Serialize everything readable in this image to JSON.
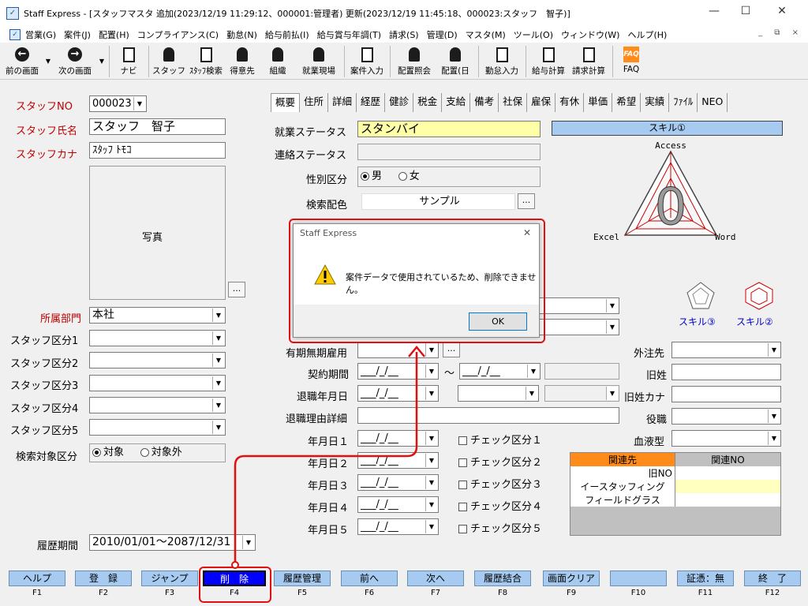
{
  "window": {
    "title": "Staff Express - [スタッフマスタ 追加(2023/12/19 11:29:12、000001:管理者) 更新(2023/12/19 11:45:18、000023:スタッフ　智子)]",
    "minimize": "—",
    "maximize": "☐",
    "close": "✕"
  },
  "menu": [
    "営業(G)",
    "案件(J)",
    "配置(H)",
    "コンプライアンス(C)",
    "勤怠(N)",
    "給与前払(I)",
    "給与賞与年調(T)",
    "請求(S)",
    "管理(D)",
    "マスタ(M)",
    "ツール(O)",
    "ウィンドウ(W)",
    "ヘルプ(H)"
  ],
  "menu_mdi": "_ ⧉ ×",
  "toolbar": [
    "前の画面",
    "次の画面",
    "ナビ",
    "スタッフ",
    "ｽﾀｯﾌ検索",
    "得意先",
    "組織",
    "就業現場",
    "案件入力",
    "配置照会",
    "配置(日",
    "勤怠入力",
    "給与計算",
    "請求計算",
    "FAQ"
  ],
  "left": {
    "staff_no_label": "スタッフNO",
    "staff_no": "000023",
    "name_label": "スタッフ氏名",
    "name": "スタッフ　智子",
    "kana_label": "スタッフカナ",
    "kana": "ｽﾀｯﾌ ﾄﾓｺ",
    "photo_label": "写真",
    "photo_btn": "...",
    "dept_label": "所属部門",
    "dept": "本社",
    "kubun": [
      "スタッフ区分1",
      "スタッフ区分2",
      "スタッフ区分3",
      "スタッフ区分4",
      "スタッフ区分5"
    ],
    "search_label": "検索対象区分",
    "search_on": "対象",
    "search_off": "対象外",
    "period_label": "履歴期間",
    "period": "2010/01/01～2087/12/31"
  },
  "tabs": [
    "概要",
    "住所",
    "詳細",
    "経歴",
    "健診",
    "税金",
    "支給",
    "備考",
    "社保",
    "雇保",
    "有休",
    "単価",
    "希望",
    "実績",
    "ﾌｧｲﾙ",
    "NEO"
  ],
  "main": {
    "work_status_label": "就業ステータス",
    "work_status": "スタンバイ",
    "contact_status_label": "連絡ステータス",
    "gender_label": "性別区分",
    "gender_m": "男",
    "gender_f": "女",
    "color_label": "検索配色",
    "color_value": "サンプル",
    "color_btn": "...",
    "contract_label": "有期無期雇用",
    "contract_btn": "...",
    "period_label": "契約期間",
    "date_blank": "___/_/__",
    "tilde": "～",
    "retire_label": "退職年月日",
    "retire_detail_label": "退職理由詳細",
    "dates": [
      "年月日１",
      "年月日２",
      "年月日３",
      "年月日４",
      "年月日５"
    ],
    "checks": [
      "チェック区分１",
      "チェック区分２",
      "チェック区分３",
      "チェック区分４",
      "チェック区分５"
    ]
  },
  "right": {
    "skill_header": "スキル①",
    "skill_big": "0",
    "axis_top": "Access",
    "axis_left": "Excel",
    "axis_right": "Word",
    "skill3": "スキル③",
    "skill2": "スキル②",
    "outsource_label": "外注先",
    "old_no_label": "旧姓",
    "old_kana_label": "旧姓カナ",
    "role_label": "役職",
    "blood_label": "血液型",
    "rel_headers": [
      "関連先",
      "関連NO"
    ],
    "rel_rows": [
      [
        "",
        "旧NO"
      ],
      [
        "イースタッフィング",
        ""
      ],
      [
        "フィールドグラス",
        ""
      ]
    ]
  },
  "dialog": {
    "title": "Staff Express",
    "close": "✕",
    "message": "案件データで使用されているため、削除できません。",
    "ok": "OK"
  },
  "fbuttons": [
    {
      "label": "ヘルプ",
      "key": "F1"
    },
    {
      "label": "登　録",
      "key": "F2"
    },
    {
      "label": "ジャンプ",
      "key": "F3"
    },
    {
      "label": "削　除",
      "key": "F4"
    },
    {
      "label": "履歴管理",
      "key": "F5"
    },
    {
      "label": "前へ",
      "key": "F6"
    },
    {
      "label": "次へ",
      "key": "F7"
    },
    {
      "label": "履歴結合",
      "key": "F8"
    },
    {
      "label": "画面クリア",
      "key": "F9"
    },
    {
      "label": "",
      "key": "F10"
    },
    {
      "label": "証憑：無",
      "key": "F11"
    },
    {
      "label": "終　了",
      "key": "F12"
    }
  ],
  "colors": {
    "accent_blue": "#a6caf0",
    "active_fkey": "#0000ff",
    "highlight_red": "#e01010",
    "yellow": "#ffffa8",
    "orange": "#ff8c1a"
  }
}
